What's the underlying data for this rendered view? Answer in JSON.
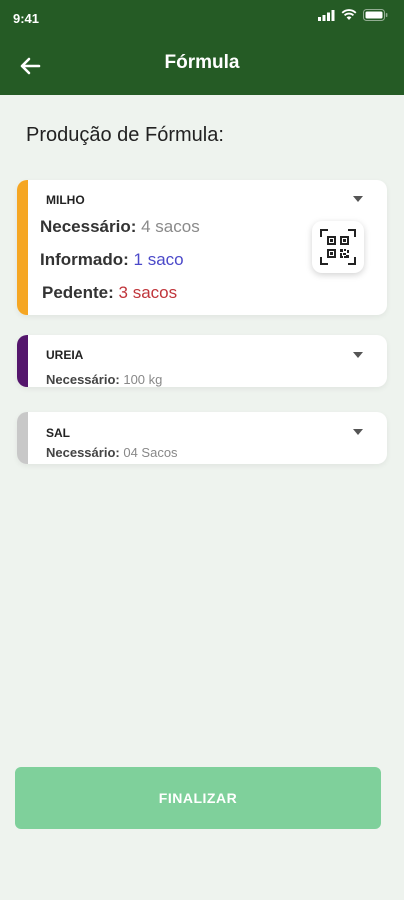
{
  "status_bar": {
    "time": "9:41"
  },
  "header": {
    "title": "Fórmula"
  },
  "section_title": "Produção de Fórmula:",
  "items": [
    {
      "name": "MILHO",
      "color": "#f5a623",
      "required_label": "Necessário:",
      "required_value": "4 sacos",
      "informed_label": "Informado:",
      "informed_value": "1 saco",
      "pending_label": "Pedente:",
      "pending_value": "3 sacos"
    },
    {
      "name": "UREIA",
      "color": "#54166c",
      "required_label": "Necessário:",
      "required_value": "100 kg"
    },
    {
      "name": "SAL",
      "color": "#c8c8c8",
      "required_label": "Necessário:",
      "required_value": "04 Sacos"
    }
  ],
  "finalize_label": "FINALIZAR",
  "colors": {
    "header": "#255b25",
    "informed": "#4b49c9",
    "pending": "#c0353b",
    "button": "#7fd09b"
  }
}
